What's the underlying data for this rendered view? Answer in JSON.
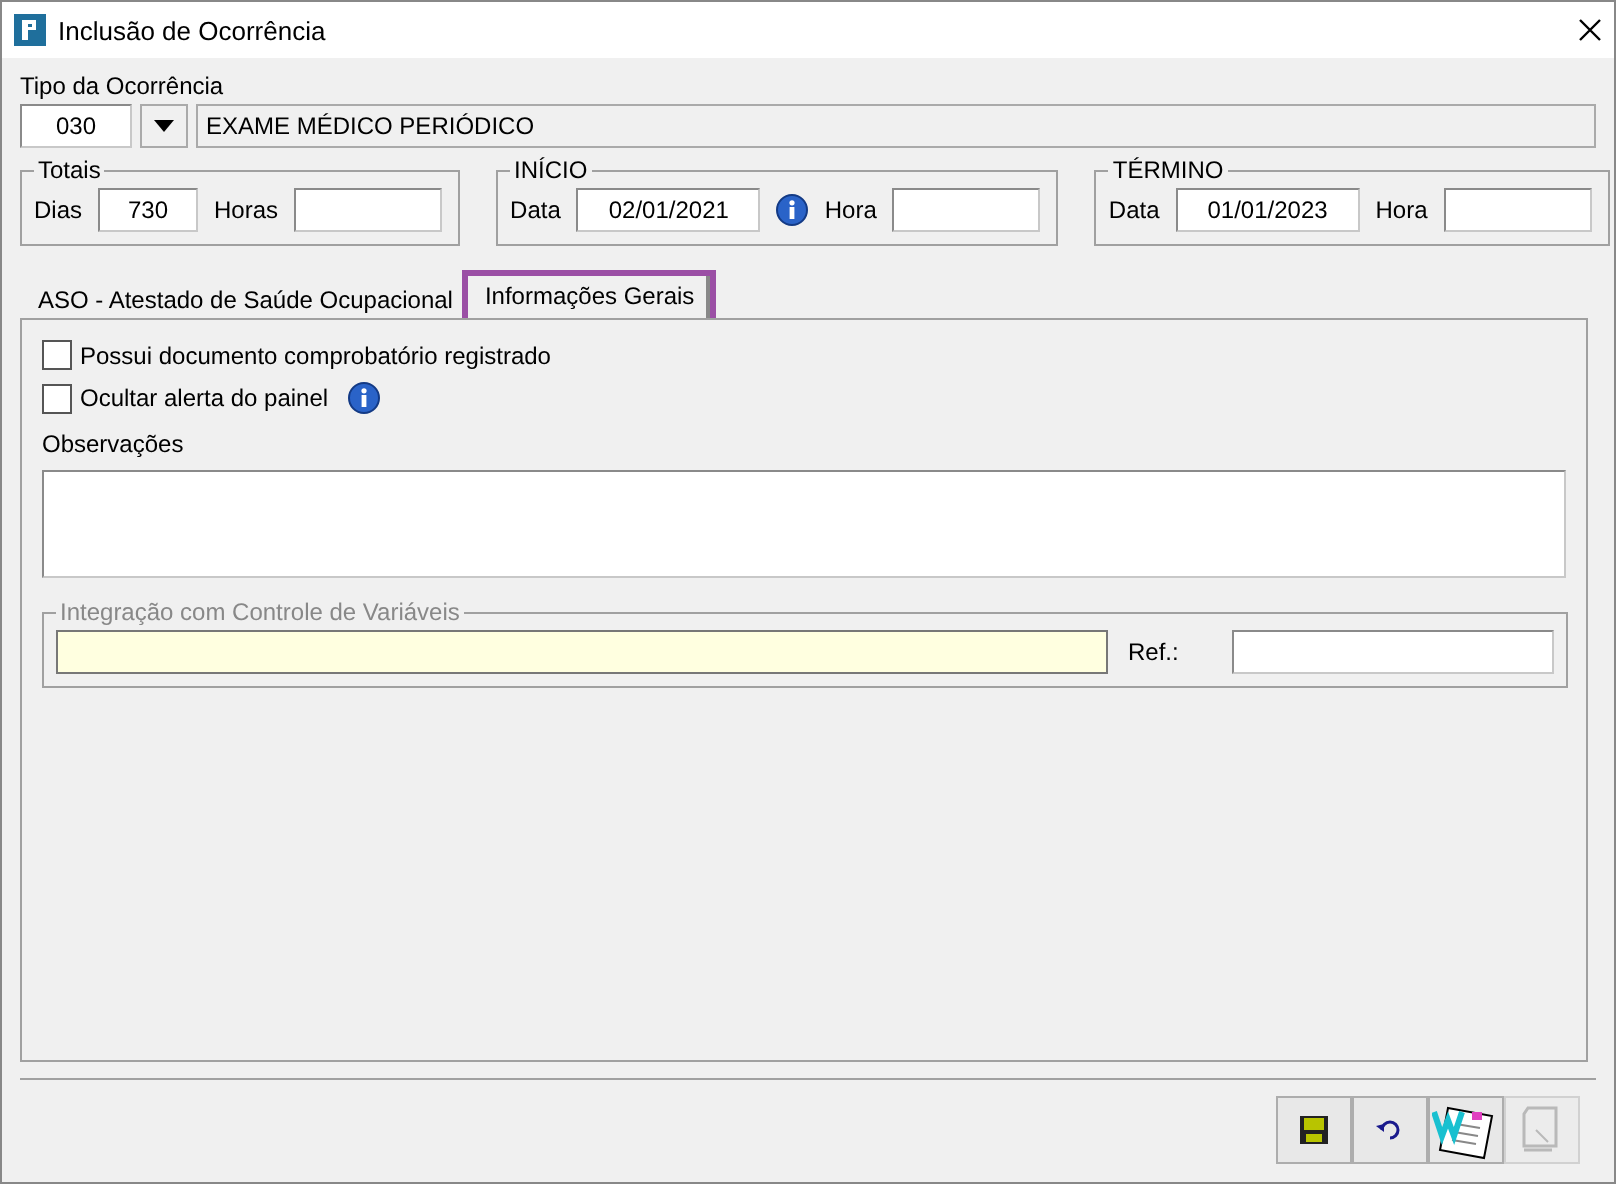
{
  "window": {
    "title": "Inclusão de Ocorrência"
  },
  "tipo": {
    "label": "Tipo da Ocorrência",
    "code": "030",
    "description": "EXAME MÉDICO PERIÓDICO"
  },
  "groups": [
    {
      "title": "Totais",
      "fields": [
        {
          "label": "Dias",
          "value": "730"
        },
        {
          "label": "Horas"
        }
      ],
      "info": false
    },
    {
      "title": "INÍCIO",
      "fields": [
        {
          "label": "Data",
          "value": "02/01/2021"
        },
        {
          "label": "Hora"
        }
      ],
      "info": true
    },
    {
      "title": "TÉRMINO",
      "fields": [
        {
          "label": "Data",
          "value": "01/01/2023"
        },
        {
          "label": "Hora"
        }
      ],
      "info": false
    }
  ],
  "tabs": [
    {
      "label": "ASO - Atestado de Saúde Ocupacional",
      "selected": false
    },
    {
      "label": "Informações Gerais",
      "selected": true
    }
  ],
  "checkboxes": [
    {
      "label": "Possui documento comprobatório registrado",
      "checked": false,
      "info": false
    },
    {
      "label": "Ocultar alerta do painel",
      "checked": false,
      "info": true
    }
  ],
  "observacoes": {
    "label": "Observações"
  },
  "integracao": {
    "title": "Integração com Controle de Variáveis",
    "disabled": true,
    "ref_label": "Ref.:"
  },
  "toolbar": [
    {
      "kind": "save",
      "disabled": false
    },
    {
      "kind": "undo",
      "disabled": false
    },
    {
      "kind": "word",
      "disabled": false
    },
    {
      "kind": "document",
      "disabled": true
    }
  ]
}
